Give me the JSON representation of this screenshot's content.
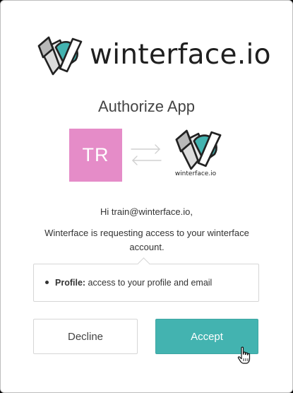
{
  "brand": {
    "name": "winterface.io",
    "logo_icon": "winterface-logo-icon",
    "accent_color": "#43b3b0"
  },
  "dialog": {
    "title": "Authorize App"
  },
  "user_avatar": {
    "initials": "TR",
    "color": "#e58cc8"
  },
  "exchange_icon": "swap-arrows-icon",
  "app": {
    "name": "winterface.io"
  },
  "greeting": "Hi train@winterface.io,",
  "request_text": "Winterface is requesting access to your winterface account.",
  "scopes": [
    {
      "name": "Profile:",
      "description": "access to your profile and email"
    }
  ],
  "buttons": {
    "decline": "Decline",
    "accept": "Accept"
  },
  "cursor": "hand-pointer-icon"
}
